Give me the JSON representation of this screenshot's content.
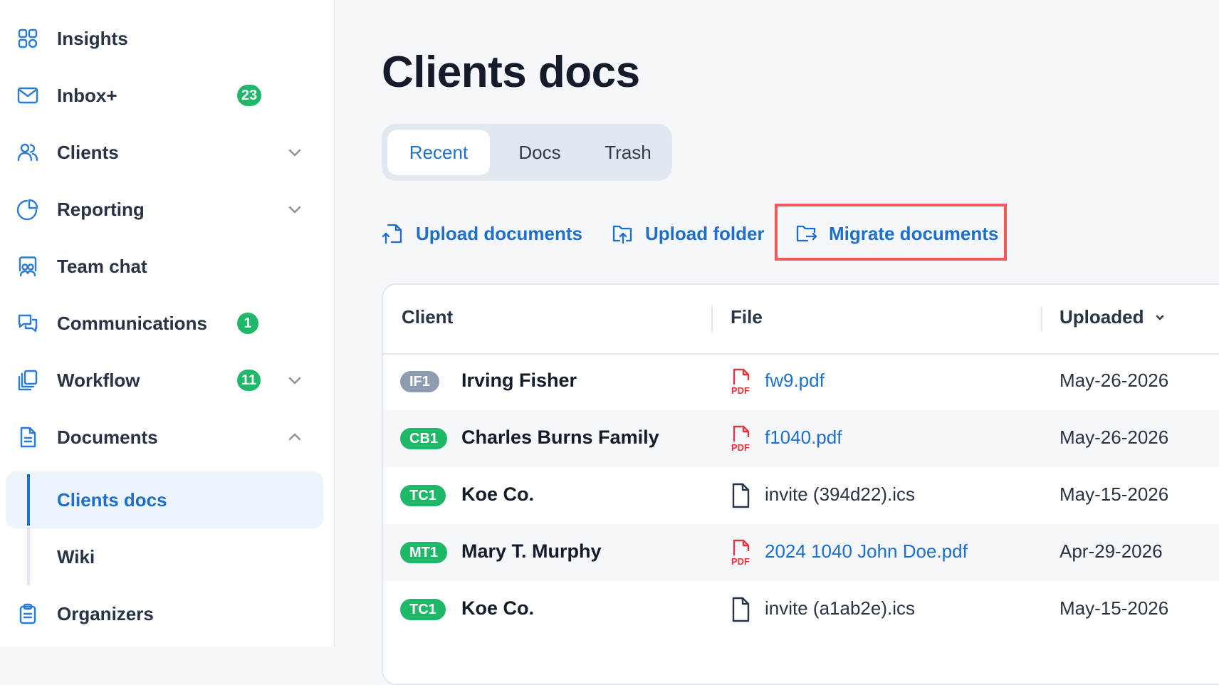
{
  "sidebar": {
    "items": [
      {
        "label": "Insights",
        "icon": "grid-icon"
      },
      {
        "label": "Inbox+",
        "icon": "mail-icon",
        "badge": "23"
      },
      {
        "label": "Clients",
        "icon": "users-icon"
      },
      {
        "label": "Reporting",
        "icon": "pie-chart-icon"
      },
      {
        "label": "Team chat",
        "icon": "team-chat-icon"
      },
      {
        "label": "Communications",
        "icon": "chat-bubbles-icon",
        "badge": "1"
      },
      {
        "label": "Workflow",
        "icon": "stacked-pages-icon",
        "badge": "11"
      },
      {
        "label": "Documents",
        "icon": "document-icon"
      },
      {
        "label": "Organizers",
        "icon": "clipboard-icon"
      }
    ],
    "documents_sub": [
      {
        "label": "Clients docs"
      },
      {
        "label": "Wiki"
      }
    ]
  },
  "main": {
    "title": "Clients docs",
    "tabs": [
      {
        "label": "Recent"
      },
      {
        "label": "Docs"
      },
      {
        "label": "Trash"
      }
    ],
    "actions": [
      {
        "label": "Upload documents",
        "icon": "upload-documents-icon"
      },
      {
        "label": "Upload folder",
        "icon": "upload-folder-icon"
      },
      {
        "label": "Migrate documents",
        "icon": "migrate-folder-icon"
      }
    ]
  },
  "table": {
    "headers": {
      "client": "Client",
      "file": "File",
      "uploaded": "Uploaded"
    },
    "rows": [
      {
        "initials": "IF1",
        "client": "Irving Fisher",
        "file": "fw9.pdf",
        "type": "pdf",
        "uploaded": "May-26-2026",
        "pill_color": "#8e9bb0"
      },
      {
        "initials": "CB1",
        "client": "Charles Burns Family",
        "file": "f1040.pdf",
        "type": "pdf",
        "uploaded": "May-26-2026",
        "pill_color": "#1fb868"
      },
      {
        "initials": "TC1",
        "client": "Koe Co.",
        "file": "invite (394d22).ics",
        "type": "generic",
        "uploaded": "May-15-2026",
        "pill_color": "#1fb868"
      },
      {
        "initials": "MT1",
        "client": "Mary T. Murphy",
        "file": "2024 1040 John Doe.pdf",
        "type": "pdf",
        "uploaded": "Apr-29-2026",
        "pill_color": "#1fb868"
      },
      {
        "initials": "TC1",
        "client": "Koe Co.",
        "file": "invite (a1ab2e).ics",
        "type": "generic",
        "uploaded": "May-15-2026",
        "pill_color": "#1fb868"
      }
    ]
  },
  "colors": {
    "accent": "#1d6fcc",
    "badge_green": "#1fb868",
    "pdf_red": "#e0353b",
    "highlight": "#ef5b5b"
  }
}
